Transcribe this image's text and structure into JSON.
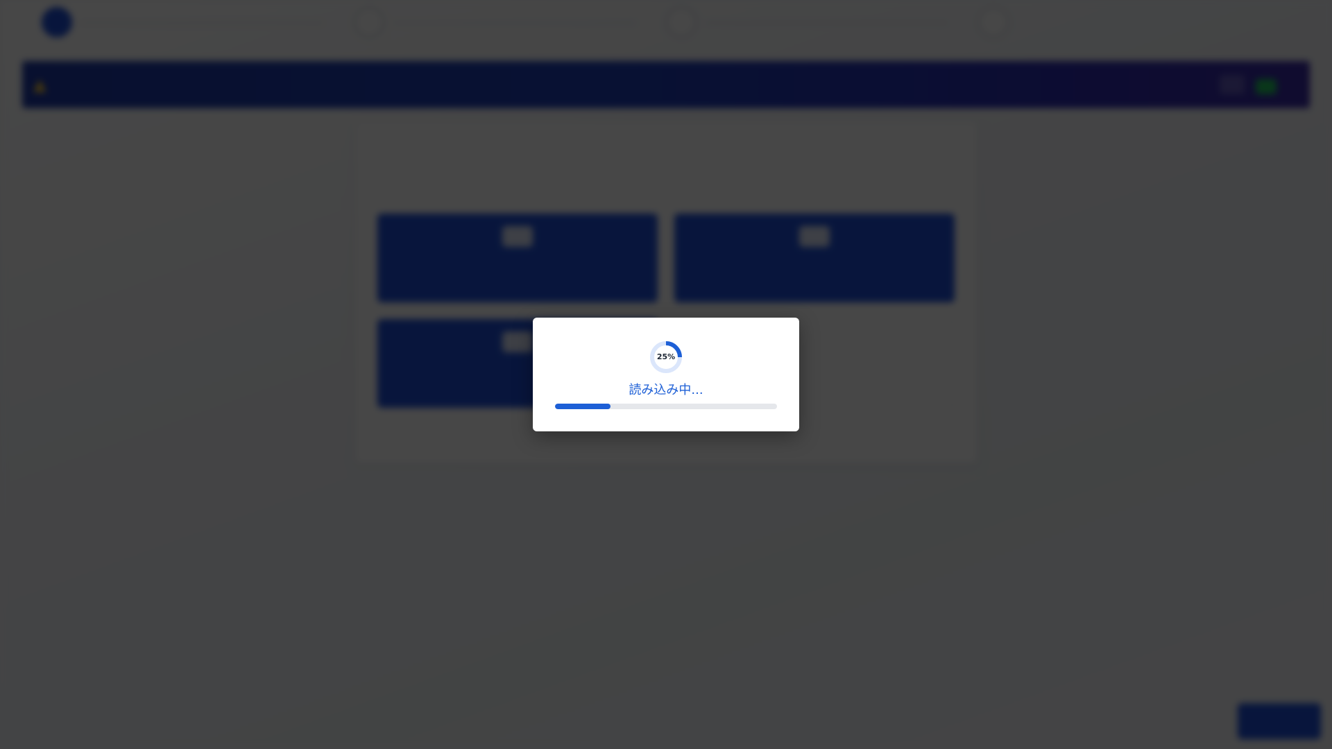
{
  "background_app": {
    "steps": [
      {
        "label": "",
        "active": true
      },
      {
        "label": "",
        "active": false
      },
      {
        "label": "",
        "active": false
      },
      {
        "label": "",
        "active": false
      }
    ]
  },
  "loading_modal": {
    "percent_label": "25%",
    "text": "読み込み中...",
    "progress": 0.25,
    "accent_color": "#1d5fd6",
    "track_color": "#e5e7eb"
  }
}
